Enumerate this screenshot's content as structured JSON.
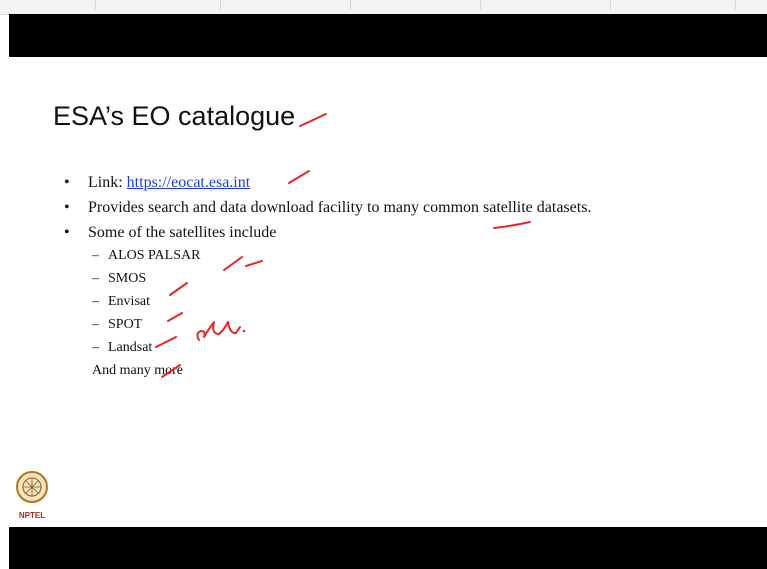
{
  "slide": {
    "title": "ESA’s EO catalogue",
    "bullets": [
      {
        "prefix": "Link: ",
        "link": "https://eocat.esa.int"
      },
      {
        "text": "Provides search and data download facility to many common satellite datasets."
      },
      {
        "text": "Some of the satellites include"
      }
    ],
    "satellites": [
      "ALOS PALSAR",
      "SMOS",
      "Envisat",
      "SPOT",
      "Landsat"
    ],
    "more": "And many more"
  },
  "logo": {
    "label": "NPTEL"
  },
  "colors": {
    "ink": "#e8242a",
    "link": "#1a3ee0",
    "bars": "#000000"
  },
  "icons": [
    "bullet-icon",
    "dash-icon",
    "nptel-logo-icon"
  ]
}
